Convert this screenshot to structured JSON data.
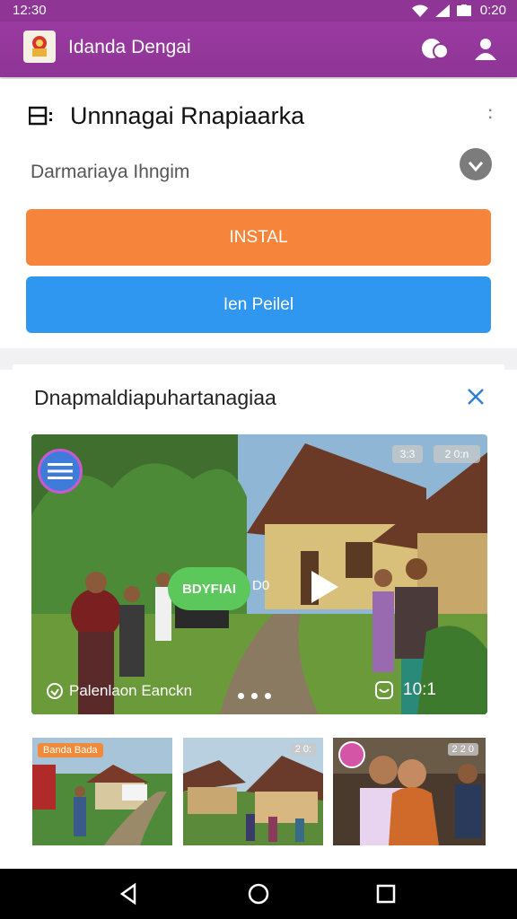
{
  "status_bar": {
    "time_left": "12:30",
    "time_right": "0:20"
  },
  "app_bar": {
    "title": "Idanda Dengai"
  },
  "app_card": {
    "name": "Unnnagai Rnapiaarka",
    "subtitle": "Darmariaya Ihngim",
    "install_label": "INSTAL",
    "secondary_label": "Ien Peilel"
  },
  "media_section": {
    "title": "Dnapmaldiapuhartanagiaa",
    "hero": {
      "badge_a": "3:3",
      "badge_b": "2 0:n",
      "pill_label": "BDYFIAI",
      "pill_side_text": "D0",
      "caption": "Palenlaon Eanckn",
      "meta_count": "10:1"
    },
    "thumbnails": [
      {
        "badge": "Banda Bada",
        "count": ""
      },
      {
        "badge": "",
        "count": "2 0:"
      },
      {
        "badge": "",
        "count": "2 2 0"
      }
    ]
  },
  "colors": {
    "brand": "#8e3596",
    "install": "#f6843a",
    "secondary": "#2f97ef",
    "pill": "#5cc85c"
  }
}
